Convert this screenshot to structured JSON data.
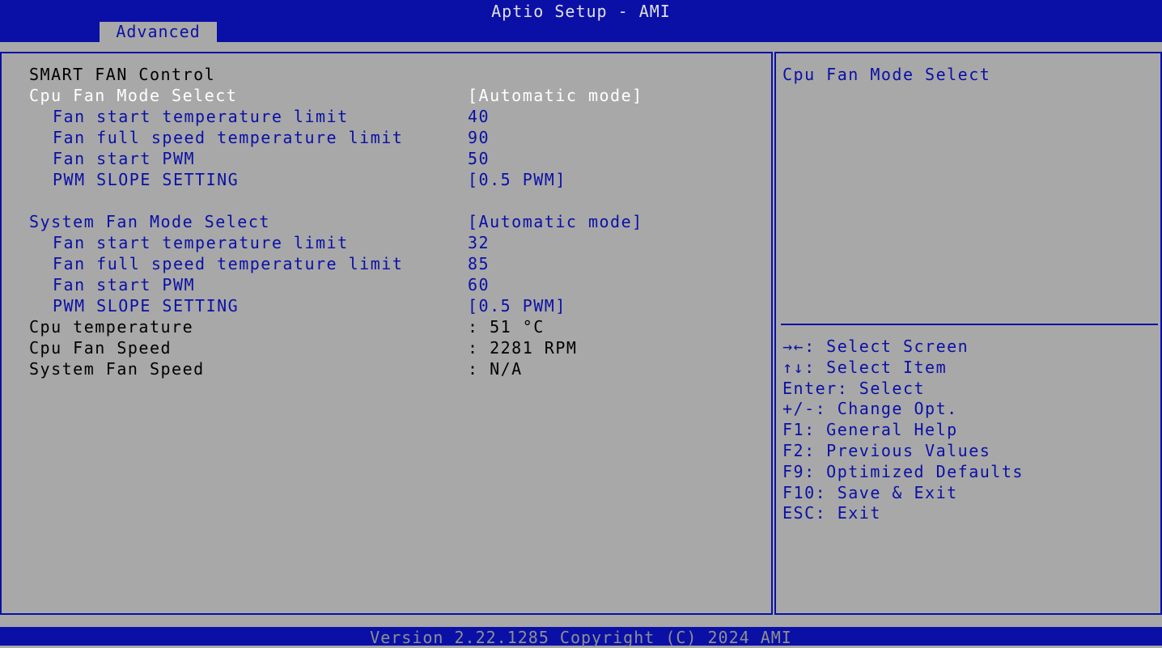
{
  "app_title": "Aptio Setup - AMI",
  "active_tab": "Advanced",
  "section_title": "SMART FAN Control",
  "cpu": {
    "mode_label": "Cpu Fan Mode Select",
    "mode_value": "[Automatic mode]",
    "start_temp_label": "Fan start temperature limit",
    "start_temp_value": "40",
    "full_speed_label": "Fan full speed temperature limit",
    "full_speed_value": "90",
    "start_pwm_label": "Fan start PWM",
    "start_pwm_value": "50",
    "slope_label": "PWM SLOPE SETTING",
    "slope_value": "[0.5 PWM]"
  },
  "system": {
    "mode_label": "System Fan Mode Select",
    "mode_value": "[Automatic mode]",
    "start_temp_label": "Fan start temperature limit",
    "start_temp_value": "32",
    "full_speed_label": "Fan full speed temperature limit",
    "full_speed_value": "85",
    "start_pwm_label": "Fan start PWM",
    "start_pwm_value": "60",
    "slope_label": "PWM SLOPE SETTING",
    "slope_value": "[0.5 PWM]"
  },
  "status": {
    "cpu_temp_label": "Cpu temperature",
    "cpu_temp_value": ": 51 °C",
    "cpu_fan_label": "Cpu Fan Speed",
    "cpu_fan_value": ": 2281 RPM",
    "sys_fan_label": "System Fan Speed",
    "sys_fan_value": ": N/A"
  },
  "help": {
    "title": "Cpu Fan Mode Select",
    "keys": [
      "→←: Select Screen",
      "↑↓: Select Item",
      "Enter: Select",
      "+/-: Change Opt.",
      "F1: General Help",
      "F2: Previous Values",
      "F9: Optimized Defaults",
      "F10: Save & Exit",
      "ESC: Exit"
    ]
  },
  "footer": "Version 2.22.1285 Copyright (C) 2024 AMI",
  "colors": {
    "header_blue": "#0a10a6",
    "panel_gray": "#a8a8a8",
    "highlight": "#ffffff"
  }
}
